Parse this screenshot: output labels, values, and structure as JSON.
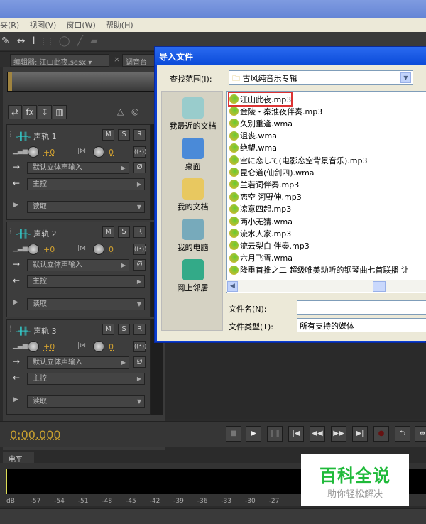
{
  "menu": [
    "夹(R)",
    "视图(V)",
    "窗口(W)",
    "帮助(H)"
  ],
  "toolbar_icons": [
    "move-tool-icon",
    "time-selection-icon",
    "razor-icon",
    "marquee-icon",
    "lasso-icon",
    "brush-icon",
    "spot-healing-icon"
  ],
  "tabs": {
    "editor": "编辑器: 江山此夜.sesx",
    "mixer": "调音台"
  },
  "track_tools": [
    "⇄",
    "fx",
    "↧",
    "▥"
  ],
  "tracks": [
    {
      "name": "声轨 1",
      "volume": "+0",
      "pan": "0",
      "input": "默认立体声输入",
      "output": "主控",
      "mode": "读取"
    },
    {
      "name": "声轨 2",
      "volume": "+0",
      "pan": "0",
      "input": "默认立体声输入",
      "output": "主控",
      "mode": "读取"
    },
    {
      "name": "声轨 3",
      "volume": "+0",
      "pan": "0",
      "input": "默认立体声输入",
      "output": "主控",
      "mode": "读取"
    }
  ],
  "track_buttons": [
    "M",
    "S",
    "R"
  ],
  "timecode": "0:00.000",
  "level_panel": {
    "tab": "电平",
    "scale": [
      "dB",
      "-57",
      "-54",
      "-51",
      "-48",
      "-45",
      "-42",
      "-39",
      "-36",
      "-33",
      "-30",
      "-27"
    ]
  },
  "watermark": {
    "title": "百科全说",
    "subtitle": "助你轻松解决"
  },
  "dialog": {
    "title": "导入文件",
    "look_in_label": "查找范围(I):",
    "look_in_value": "古风纯音乐专辑",
    "places": [
      "我最近的文档",
      "桌面",
      "我的文档",
      "我的电脑",
      "网上邻居"
    ],
    "files": [
      "江山此夜.mp3",
      "金陵・秦淮夜伴奏.mp3",
      "久别重逢.wma",
      "沮丧.wma",
      "绝望.wma",
      "空に恋して(电影恋空背景音乐).mp3",
      "昆仑道(仙剑四).wma",
      "兰若词伴奏.mp3",
      "恋空 河野伸.mp3",
      "凉意四起.mp3",
      "两小无猜.wma",
      "流水人家.mp3",
      "流云梨白 伴奏.mp3",
      "六月飞雪.wma",
      "隆重首推之二 超级唯美动听的钢琴曲七首联播 让"
    ],
    "selected_file": "江山此夜.mp3",
    "filename_label": "文件名(N):",
    "filename_value": "",
    "filetype_label": "文件类型(T):",
    "filetype_value": "所有支持的媒体"
  }
}
